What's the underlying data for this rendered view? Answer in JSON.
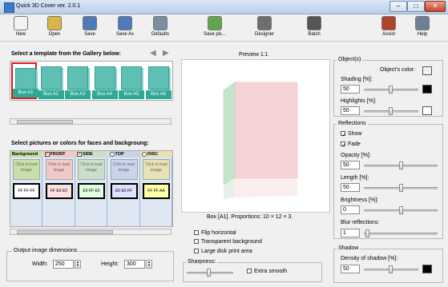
{
  "window": {
    "title": "Quick 3D Cover ver. 2.0.1"
  },
  "toolbar": [
    {
      "label": "New",
      "icon": "new-icon",
      "color": "#f3f3f3"
    },
    {
      "label": "Open",
      "icon": "open-icon",
      "color": "#d8b34a"
    },
    {
      "label": "Save",
      "icon": "save-icon",
      "color": "#4f79b9"
    },
    {
      "label": "Save As",
      "icon": "save-as-icon",
      "color": "#4f79b9"
    },
    {
      "label": "Defaults",
      "icon": "defaults-icon",
      "color": "#7a8fa6"
    },
    {
      "label": "Save pic...",
      "icon": "save-picture-icon",
      "color": "#60a64a"
    },
    {
      "label": "Designer",
      "icon": "designer-icon",
      "color": "#6e6e6e"
    },
    {
      "label": "Batch",
      "icon": "batch-icon",
      "color": "#555555"
    },
    {
      "label": "Assist",
      "icon": "assist-icon",
      "color": "#b0412c"
    },
    {
      "label": "Help",
      "icon": "help-icon",
      "color": "#6f7f93"
    }
  ],
  "gallery": {
    "title": "Select a template from the Gallery below:",
    "items": [
      "Box A1",
      "Box A2",
      "Box A3",
      "Box A4",
      "Box A5",
      "Box A6"
    ],
    "selected_index": 0
  },
  "faces": {
    "title": "Select pictures or colors for faces and backgroung:",
    "load_text": "Click to load image",
    "items": [
      {
        "name": "Background",
        "color_label": "FF FF FF",
        "bg": "#ffffff",
        "header_bg": "#c8e0a8",
        "marker": "none"
      },
      {
        "name": "FRONT",
        "color_label": "FF E0 E0",
        "bg": "#ffe0e0",
        "header_bg": "#f2c9c9",
        "marker": "checkbox"
      },
      {
        "name": "SIDE",
        "color_label": "E0 FF E0",
        "bg": "#e0ffe0",
        "header_bg": "#c9dfcb",
        "marker": "checkbox"
      },
      {
        "name": "TOP",
        "color_label": "E0 E0 FF",
        "bg": "#e0e0ff",
        "header_bg": "#c9d4ea",
        "marker": "radio"
      },
      {
        "name": "DISC",
        "color_label": "FF FF AA",
        "bg": "#ffffaa",
        "header_bg": "#e6e2b5",
        "marker": "radio"
      }
    ]
  },
  "output": {
    "title": "Output image dimensions",
    "width_label": "Width:",
    "width_value": "250",
    "height_label": "Height:",
    "height_value": "300"
  },
  "preview": {
    "title": "Preview 1:1",
    "caption": "Box [A1]. Proportions: 10 × 12 × 3.",
    "front_color": "#f4d4d6",
    "side_color": "#c4e4cb"
  },
  "options": {
    "flip_horizontal": "Flip horizontal",
    "transparent_background": "Transparent background",
    "large_disk_print_area": "Large disk print area",
    "sharpness": "Sharpness:",
    "extra_smooth": "Extra smooth"
  },
  "objects": {
    "title": "Object(s)",
    "color_label": "Object's color:",
    "shading_label": "Shading [%]:",
    "shading_value": "50",
    "highlights_label": "Highlights [%]:",
    "highlights_value": "50"
  },
  "reflections": {
    "title": "Reflections",
    "show_label": "Show",
    "fade_label": "Fade",
    "opacity_label": "Opacity [%]:",
    "opacity_value": "50",
    "length_label": "Length [%]:",
    "length_value": "50",
    "brightness_label": "Brightness [%]:",
    "brightness_value": "0",
    "blur_label": "Blur reflections:",
    "blur_value": "1"
  },
  "shadow": {
    "title": "Shadow",
    "density_label": "Density of shadow [%]:",
    "density_value": "50"
  }
}
